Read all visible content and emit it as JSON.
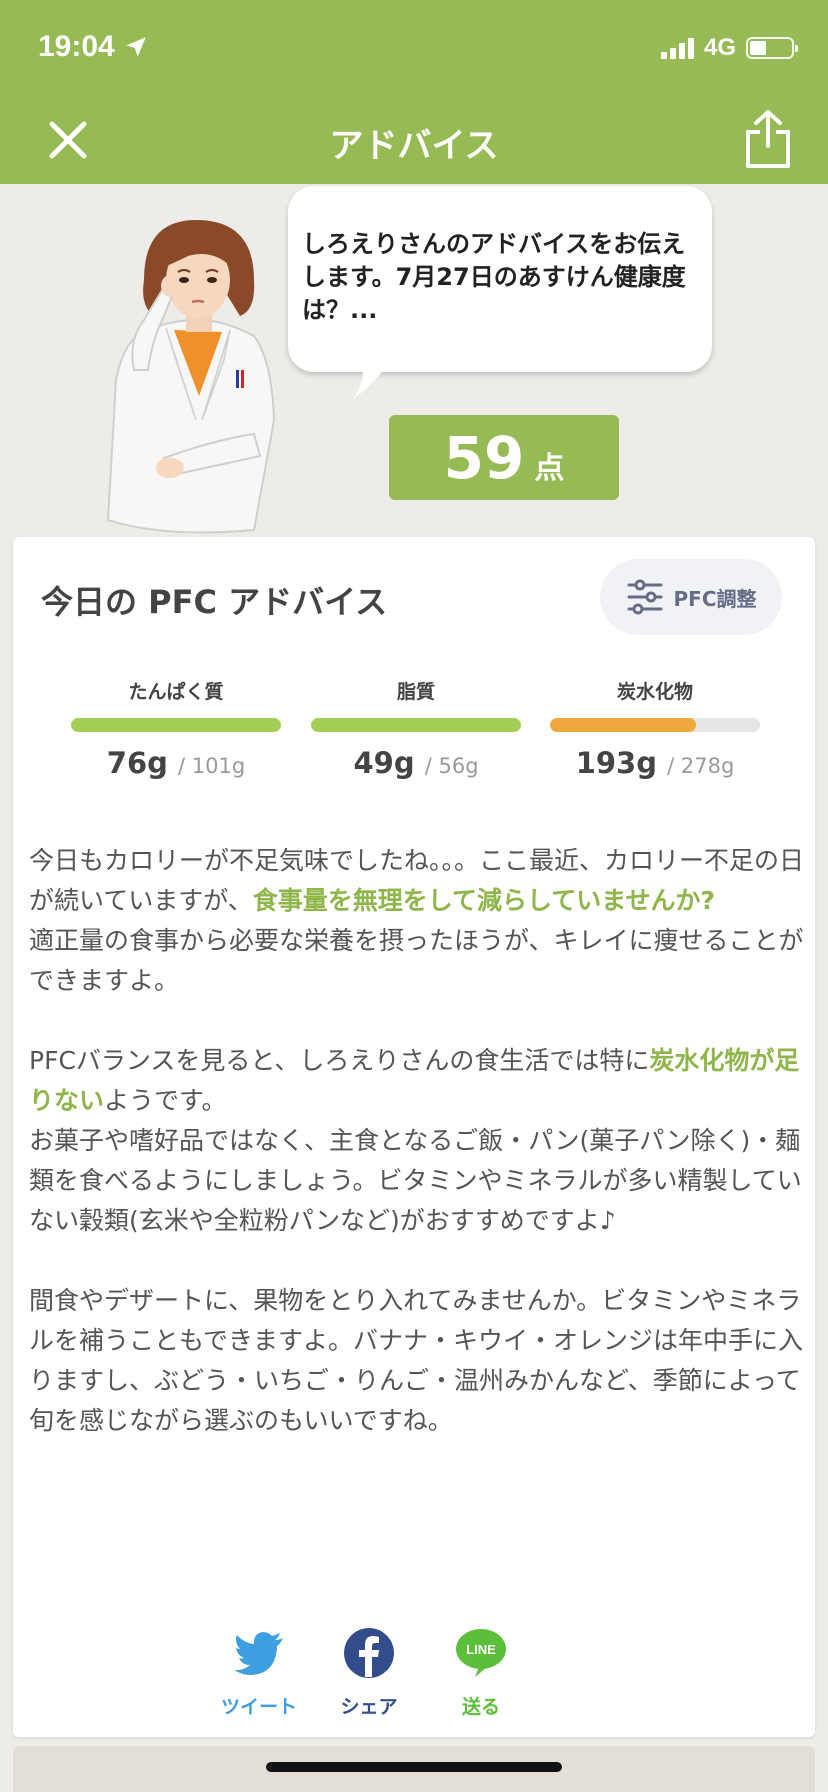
{
  "status": {
    "time": "19:04",
    "network": "4G"
  },
  "header": {
    "title": "アドバイス"
  },
  "advisor": {
    "message": "しろえりさんのアドバイスをお伝えします。7月27日のあすけん健康度は？...",
    "score": "59",
    "score_unit": "点"
  },
  "card": {
    "title": "今日の PFC アドバイス",
    "adjust_label": "PFC調整",
    "nutrients": [
      {
        "label": "たんぱく質",
        "value": "76g",
        "target": "101g",
        "ratio": 1.0,
        "color": "#a4cf56"
      },
      {
        "label": "脂質",
        "value": "49g",
        "target": "56g",
        "ratio": 1.0,
        "color": "#a4cf56"
      },
      {
        "label": "炭水化物",
        "value": "193g",
        "target": "278g",
        "ratio": 0.694,
        "color": "#efa83c"
      }
    ],
    "paragraphs": [
      {
        "a": "今日もカロリーが不足気味でしたね。。。ここ最近、カロリー不足の日が続いていますが、",
        "highlight": "食事量を無理をして減らしていませんか?",
        "b": "適正量の食事から必要な栄養を摂ったほうが、キレイに痩せることができますよ。"
      },
      {
        "a": "PFCバランスを見ると、しろえりさんの食生活では特に",
        "highlight": "炭水化物が足りない",
        "b": "ようです。",
        "c": "お菓子や嗜好品ではなく、主食となるご飯・パン(菓子パン除く)・麺類を食べるようにしましょう。ビタミンやミネラルが多い精製していない穀類(玄米や全粒粉パンなど)がおすすめですよ♪"
      },
      {
        "a": "間食やデザートに、果物をとり入れてみませんか。ビタミンやミネラルを補うこともできますよ。バナナ・キウイ・オレンジは年中手に入りますし、ぶどう・いちご・りんご・温州みかんなど、季節によって旬を感じながら選ぶのもいいですね。"
      }
    ],
    "social": {
      "tweet": "ツイート",
      "share": "シェア",
      "send": "送る",
      "line_logo": "LINE"
    }
  },
  "colors": {
    "header": "#96bb55",
    "highlight": "#8fb64a",
    "twitter": "#3d9fe0",
    "facebook": "#334d8c",
    "line": "#5cbf3a"
  }
}
